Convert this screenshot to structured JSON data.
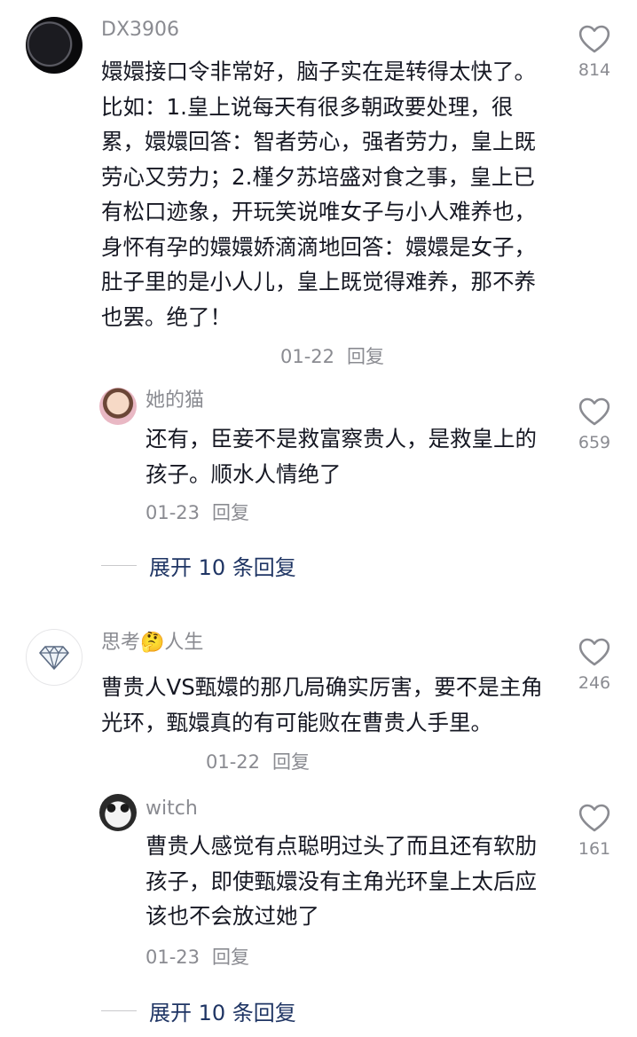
{
  "comments": [
    {
      "username": "DX3906",
      "text": "嬛嬛接口令非常好，脑子实在是转得太快了。比如：1.皇上说每天有很多朝政要处理，很累，嬛嬛回答：智者劳心，强者劳力，皇上既劳心又劳力；2.槿夕苏培盛对食之事，皇上已有松口迹象，开玩笑说唯女子与小人难养也，身怀有孕的嬛嬛娇滴滴地回答：嬛嬛是女子，肚子里的是小人儿，皇上既觉得难养，那不养也罢。绝了！",
      "date": "01-22",
      "reply_label": "回复",
      "likes": "814",
      "reply": {
        "username": "她的猫",
        "text": "还有，臣妾不是救富察贵人，是救皇上的孩子。顺水人情绝了",
        "date": "01-23",
        "reply_label": "回复",
        "likes": "659"
      },
      "expand_label": "展开 10 条回复"
    },
    {
      "username": "思考🤔人生",
      "text": "曹贵人VS甄嬛的那几局确实厉害，要不是主角光环，甄嬛真的有可能败在曹贵人手里。",
      "date": "01-22",
      "reply_label": "回复",
      "likes": "246",
      "reply": {
        "username": "witch",
        "text": "曹贵人感觉有点聪明过头了而且还有软肋孩子，即使甄嬛没有主角光环皇上太后应该也不会放过她了",
        "date": "01-23",
        "reply_label": "回复",
        "likes": "161"
      },
      "expand_label": "展开 10 条回复"
    }
  ],
  "icons": {
    "like": "heart-outline-icon"
  }
}
